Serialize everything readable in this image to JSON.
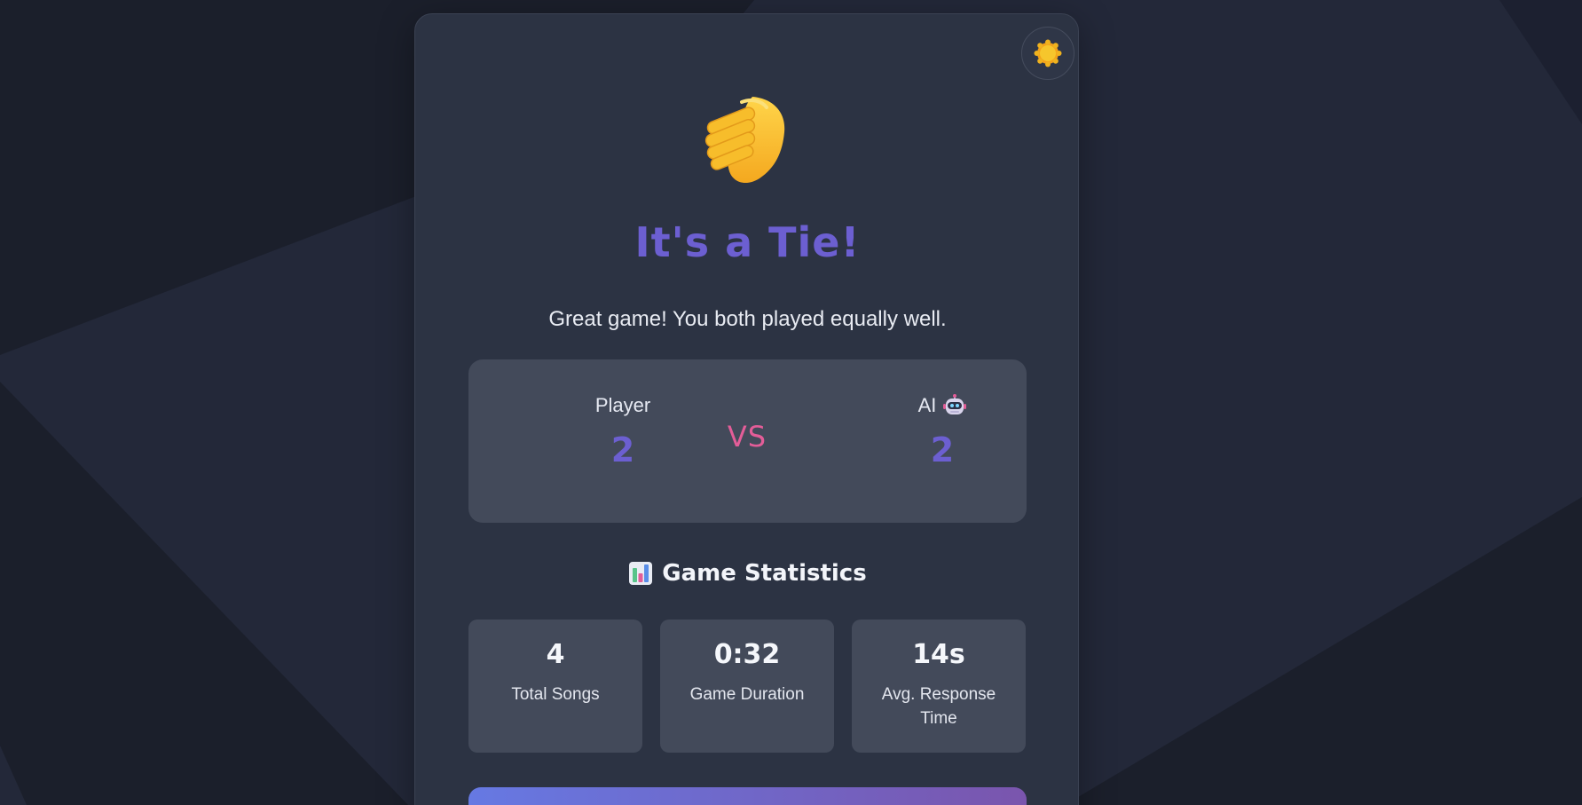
{
  "theme_toggle": {
    "icon": "sun-icon"
  },
  "hero": {
    "icon": "handshake-icon"
  },
  "result": {
    "title": "It's a Tie!",
    "subtitle": "Great game! You both played equally well."
  },
  "scoreboard": {
    "player": {
      "label": "Player",
      "score": "2"
    },
    "vs_label": "VS",
    "ai": {
      "label": "AI",
      "icon": "robot-icon",
      "score": "2"
    }
  },
  "statistics": {
    "heading_icon": "bar-chart-icon",
    "heading": "Game Statistics",
    "items": [
      {
        "value": "4",
        "label": "Total Songs"
      },
      {
        "value": "0:32",
        "label": "Game Duration"
      },
      {
        "value": "14s",
        "label": "Avg. Response Time"
      }
    ]
  },
  "colors": {
    "accent": "#6c5fd1",
    "vs": "#e35d98",
    "card": "#2c3343",
    "panel": "#434a5a",
    "background": "#1b1f2b"
  }
}
